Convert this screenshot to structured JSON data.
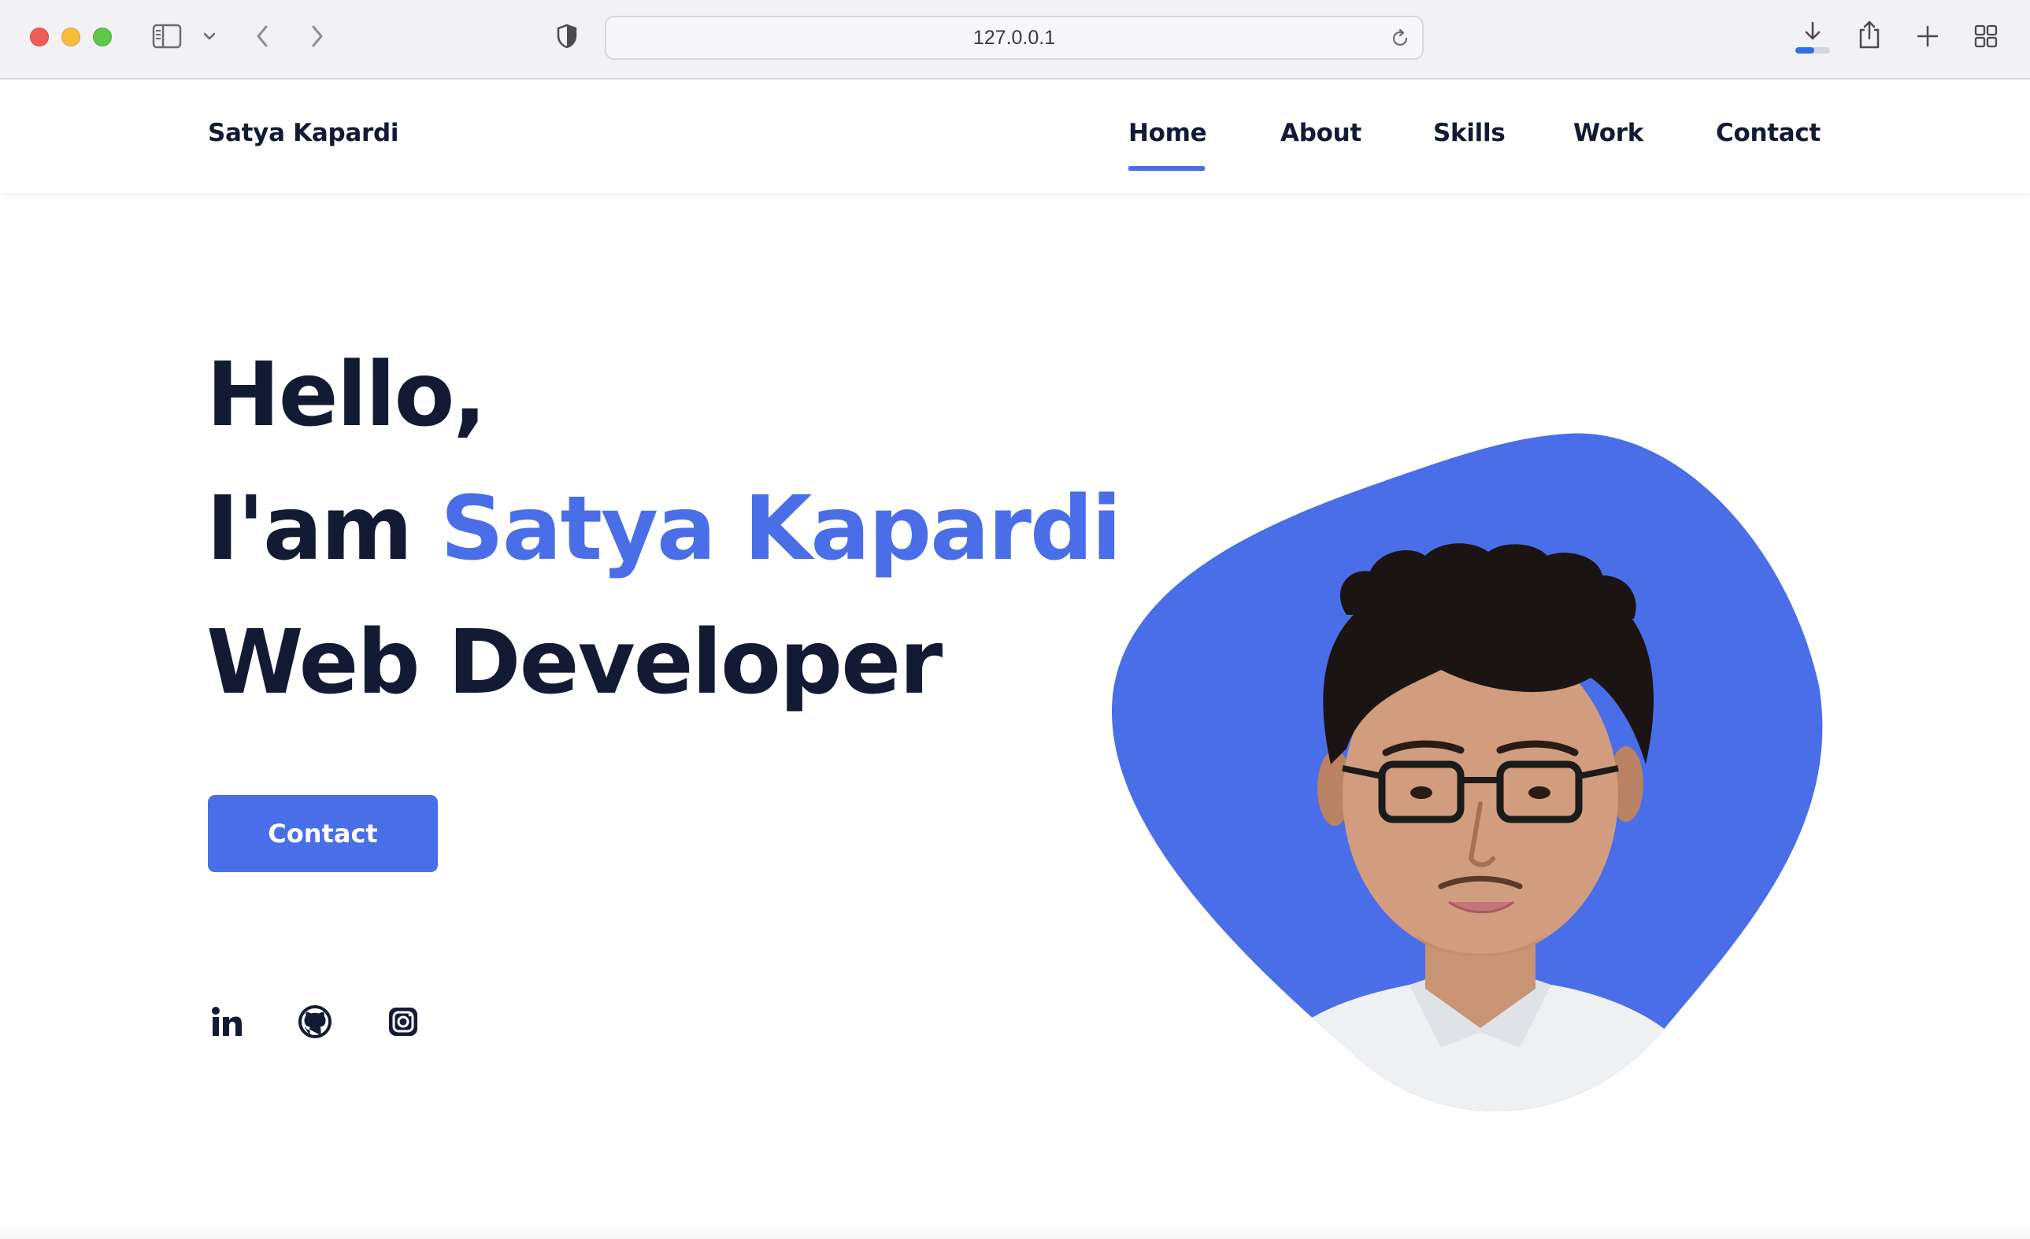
{
  "browser": {
    "url": "127.0.0.1",
    "download_progress": 0.55
  },
  "site": {
    "logo": "Satya Kapardi",
    "nav": [
      {
        "label": "Home",
        "active": true
      },
      {
        "label": "About",
        "active": false
      },
      {
        "label": "Skills",
        "active": false
      },
      {
        "label": "Work",
        "active": false
      },
      {
        "label": "Contact",
        "active": false
      }
    ]
  },
  "hero": {
    "line1": "Hello,",
    "line2_prefix": "I'am ",
    "line2_name": "Satya Kapardi",
    "line3": "Web Developer",
    "cta_label": "Contact"
  },
  "social": [
    {
      "icon": "linkedin-icon"
    },
    {
      "icon": "github-icon"
    },
    {
      "icon": "instagram-icon"
    }
  ],
  "colors": {
    "accent": "#4a6ee8",
    "text_dark": "#131b34",
    "blob": "#4a6ee8"
  }
}
